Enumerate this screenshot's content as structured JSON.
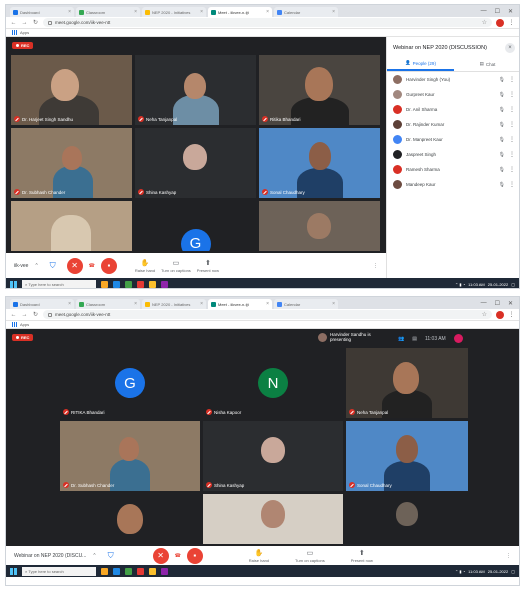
{
  "browser": {
    "tabs": [
      {
        "label": "Dashboard",
        "color": "#1a73e8",
        "active": false
      },
      {
        "label": "Classroom",
        "color": "#34a853",
        "active": false
      },
      {
        "label": "NEP 2020 - Initiatives",
        "color": "#fbbc04",
        "active": false
      },
      {
        "label": "Meet - iikvee-n-tjt",
        "color": "#00897b",
        "active": true
      },
      {
        "label": "Calendar",
        "color": "#4285f4",
        "active": false
      }
    ],
    "url": "meet.google.com/iik-vee-ntt",
    "bookmark": "Apps",
    "window_controls": [
      "—",
      "☐",
      "✕"
    ]
  },
  "recording_label": "REC",
  "screen1": {
    "tiles": [
      {
        "name": "Dr. Harjeet Singh Sandhu",
        "kind": "video"
      },
      {
        "name": "Neha Tanjanpal",
        "kind": "video"
      },
      {
        "name": "Ritika Bhandari",
        "kind": "video"
      },
      {
        "name": "Dr. Subhash Chander",
        "kind": "video"
      },
      {
        "name": "Shina Kashyap",
        "kind": "video"
      },
      {
        "name": "Sonal Chaudhary",
        "kind": "video"
      },
      {
        "name": "",
        "kind": "video"
      },
      {
        "name": "",
        "kind": "avatar",
        "letter": "G",
        "color": "#1a73e8"
      },
      {
        "name": "",
        "kind": "video"
      }
    ],
    "controls": {
      "meeting_code": "iik-vee",
      "raise_hand": "Raise hand",
      "captions": "Turn on captions",
      "present": "Present now"
    },
    "panel": {
      "title": "Webinar on NEP 2020 (DISCUSSION)",
      "tab_people": "People (29)",
      "tab_chat": "Chat",
      "people": [
        {
          "name": "Harvinder Singh (You)",
          "color": "#8d6e63"
        },
        {
          "name": "Gurpreet Kaur",
          "color": "#a1887f"
        },
        {
          "name": "Dr. Anil Sharma",
          "color": "#d93025"
        },
        {
          "name": "Dr. Rajinder Kumar",
          "color": "#5d4037"
        },
        {
          "name": "Dr. Manpreet Kaur",
          "color": "#4285f4"
        },
        {
          "name": "Jaspreet Singh",
          "color": "#202124"
        },
        {
          "name": "Ramesh Sharma",
          "color": "#d93025"
        },
        {
          "name": "Mandeep Kaur",
          "color": "#6d4c41"
        }
      ]
    }
  },
  "screen2": {
    "tiles": [
      {
        "name": "RITIKA Bhandari",
        "kind": "avatar",
        "letter": "G",
        "color": "#1a73e8"
      },
      {
        "name": "Nisha Kapoor",
        "kind": "avatar",
        "letter": "N",
        "color": "#0b8043"
      },
      {
        "name": "Neha Tanjanpal",
        "kind": "video"
      },
      {
        "name": "Dr. Subhash Chander",
        "kind": "video"
      },
      {
        "name": "Shina Kashyap",
        "kind": "video"
      },
      {
        "name": "Sonal Chaudhary",
        "kind": "video"
      },
      {
        "name": "",
        "kind": "video"
      },
      {
        "name": "",
        "kind": "video"
      },
      {
        "name": "",
        "kind": "video"
      }
    ],
    "presenting": "Harvinder Sandhu is presenting",
    "time": "11:03 AM",
    "controls": {
      "meeting_title": "Webinar on NEP 2020 (DISCU...",
      "raise_hand": "Raise hand",
      "captions": "Turn on captions",
      "present": "Present now"
    }
  },
  "taskbar": {
    "search_placeholder": "Type here to search",
    "time": "11:03 AM",
    "date": "25-01-2022"
  }
}
